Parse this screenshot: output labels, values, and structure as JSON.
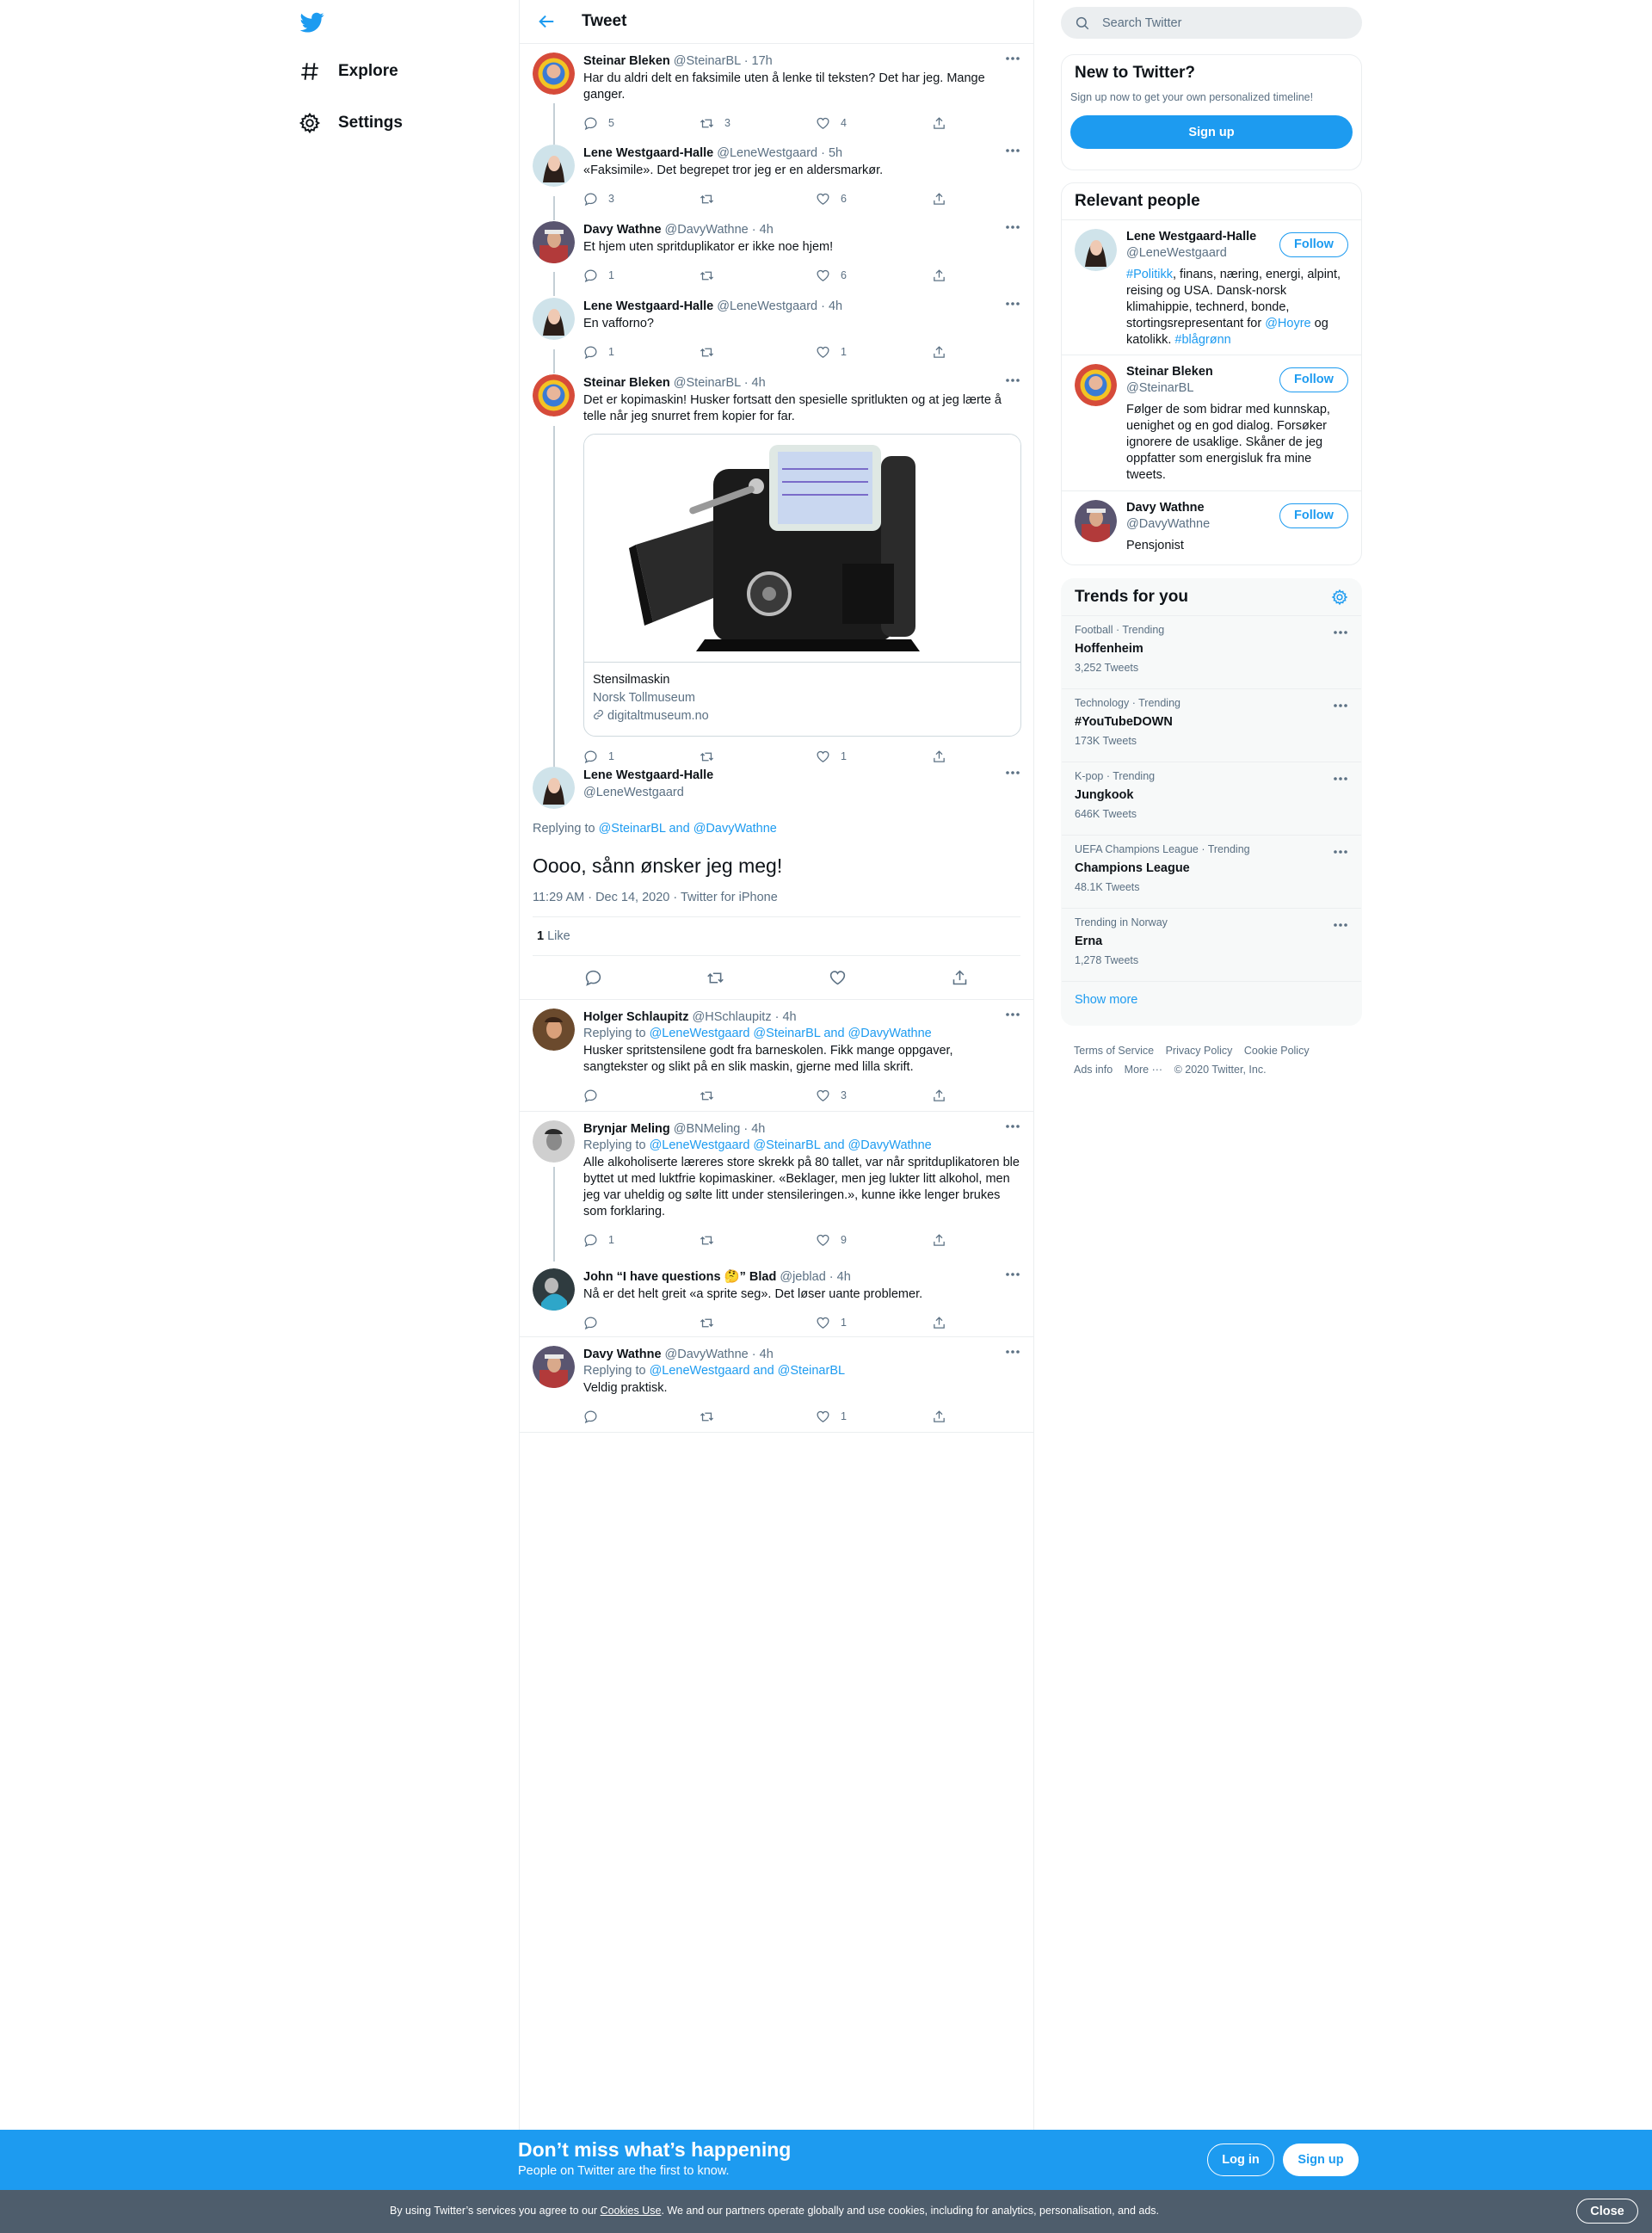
{
  "nav": {
    "logo": "twitter-bird-icon",
    "items": [
      {
        "label": "Explore",
        "icon": "hashtag-icon"
      },
      {
        "label": "Settings",
        "icon": "gear-icon"
      }
    ]
  },
  "header": {
    "title": "Tweet"
  },
  "thread": [
    {
      "name": "Steinar Bleken",
      "handle": "@SteinarBL",
      "time": "· 17h",
      "text": "Har du aldri delt en faksimile uten å lenke til teksten?  Det har jeg. Mange ganger.",
      "replies": "5",
      "retweets": "3",
      "likes": "4"
    },
    {
      "name": "Lene Westgaard-Halle",
      "handle": "@LeneWestgaard",
      "time": "· 5h",
      "text": "«Faksimile». Det begrepet tror jeg er en aldersmarkør.",
      "replies": "3",
      "retweets": "",
      "likes": "6"
    },
    {
      "name": "Davy Wathne",
      "handle": "@DavyWathne",
      "time": "· 4h",
      "text": "Et hjem uten spritduplikator er ikke noe hjem!",
      "replies": "1",
      "retweets": "",
      "likes": "6"
    },
    {
      "name": "Lene Westgaard-Halle",
      "handle": "@LeneWestgaard",
      "time": "· 4h",
      "text": "En vafforno?",
      "replies": "1",
      "retweets": "",
      "likes": "1"
    },
    {
      "name": "Steinar Bleken",
      "handle": "@SteinarBL",
      "time": "· 4h",
      "text": "Det er kopimaskin! Husker fortsatt den spesielle spritlukten og at jeg lærte å telle når jeg snurret frem kopier for far.",
      "replies": "1",
      "retweets": "",
      "likes": "1",
      "card": {
        "title": "Stensilmaskin",
        "subtitle": "Norsk Tollmuseum",
        "domain": "digitaltmuseum.no"
      }
    }
  ],
  "main_tweet": {
    "name": "Lene Westgaard-Halle",
    "handle": "@LeneWestgaard",
    "replying_prefix": "Replying to",
    "replying_to": "@SteinarBL and @DavyWathne",
    "text": "Oooo, sånn ønsker jeg meg!",
    "meta": "11:29 AM · Dec 14, 2020 · Twitter for iPhone",
    "likes_count": "1",
    "likes_label": "Like"
  },
  "replies": [
    {
      "name": "Holger Schlaupitz",
      "handle": "@HSchlaupitz",
      "time": "· 4h",
      "replying_to": "@LeneWestgaard @SteinarBL and @DavyWathne",
      "text": "Husker spritstensilene godt fra barneskolen. Fikk mange oppgaver, sangtekster og slikt på en slik maskin, gjerne med lilla skrift.",
      "replies": "",
      "retweets": "",
      "likes": "3"
    },
    {
      "name": "Brynjar Meling",
      "handle": "@BNMeling",
      "time": "· 4h",
      "replying_to": "@LeneWestgaard @SteinarBL and @DavyWathne",
      "text": "Alle alkoholiserte læreres store skrekk på 80 tallet, var når spritduplikatoren ble byttet ut med luktfrie kopimaskiner.  «Beklager, men jeg lukter litt alkohol, men jeg var uheldig og sølte litt under stensileringen.», kunne ikke lenger brukes som forklaring.",
      "replies": "1",
      "retweets": "",
      "likes": "9"
    },
    {
      "name": "John “I have questions 🤔” Blad",
      "handle": "@jeblad",
      "time": "· 4h",
      "replying_to": "",
      "text": "Nå er det helt greit «a sprite seg». Det løser uante problemer.",
      "replies": "",
      "retweets": "",
      "likes": "1"
    },
    {
      "name": "Davy Wathne",
      "handle": "@DavyWathne",
      "time": "· 4h",
      "replying_to": "@LeneWestgaard and @SteinarBL",
      "text": "Veldig praktisk.",
      "replies": "",
      "retweets": "",
      "likes": "1"
    }
  ],
  "search": {
    "placeholder": "Search Twitter"
  },
  "new_panel": {
    "title": "New to Twitter?",
    "subtitle": "Sign up now to get your own personalized timeline!",
    "button": "Sign up"
  },
  "people": {
    "title": "Relevant people",
    "follow_label": "Follow",
    "list": [
      {
        "name": "Lene Westgaard-Halle",
        "handle": "@LeneWestgaard"
      },
      {
        "name": "Steinar Bleken",
        "handle": "@SteinarBL",
        "bio": "Følger de som bidrar med kunnskap, uenighet og en god dialog. Forsøker ignorere de usaklige. Skåner de jeg oppfatter som energisluk fra mine tweets."
      },
      {
        "name": "Davy Wathne",
        "handle": "@DavyWathne",
        "bio": "Pensjonist"
      }
    ],
    "bio0": {
      "tag1": "#Politikk",
      "part1": ", finans, næring, energi, alpint, reising og USA. Dansk-norsk klimahippie, technerd, bonde, stortingsrepresentant for ",
      "mention": "@Hoyre",
      "part2": " og katolikk. ",
      "tag2": "#blågrønn"
    }
  },
  "trends": {
    "title": "Trends for you",
    "list": [
      {
        "category": "Football · Trending",
        "name": "Hoffenheim",
        "count": "3,252 Tweets"
      },
      {
        "category": "Technology · Trending",
        "name": "#YouTubeDOWN",
        "count": "173K Tweets"
      },
      {
        "category": "K-pop · Trending",
        "name": "Jungkook",
        "count": "646K Tweets"
      },
      {
        "category": "UEFA Champions League · Trending",
        "name": "Champions League",
        "count": "48.1K Tweets"
      },
      {
        "category": "Trending in Norway",
        "name": "Erna",
        "count": "1,278 Tweets"
      }
    ],
    "show_more": "Show more"
  },
  "footer": {
    "links": [
      "Terms of Service",
      "Privacy Policy",
      "Cookie Policy",
      "Ads info",
      "More ···",
      "© 2020 Twitter, Inc."
    ]
  },
  "cta": {
    "title": "Don’t miss what’s happening",
    "subtitle": "People on Twitter are the first to know.",
    "login": "Log in",
    "signup": "Sign up"
  },
  "cookie": {
    "prefix": "By using Twitter’s services you agree to our ",
    "link": "Cookies Use",
    "suffix": ". We and our partners operate globally and use cookies, including for analytics, personalisation, and ads.",
    "close": "Close"
  }
}
